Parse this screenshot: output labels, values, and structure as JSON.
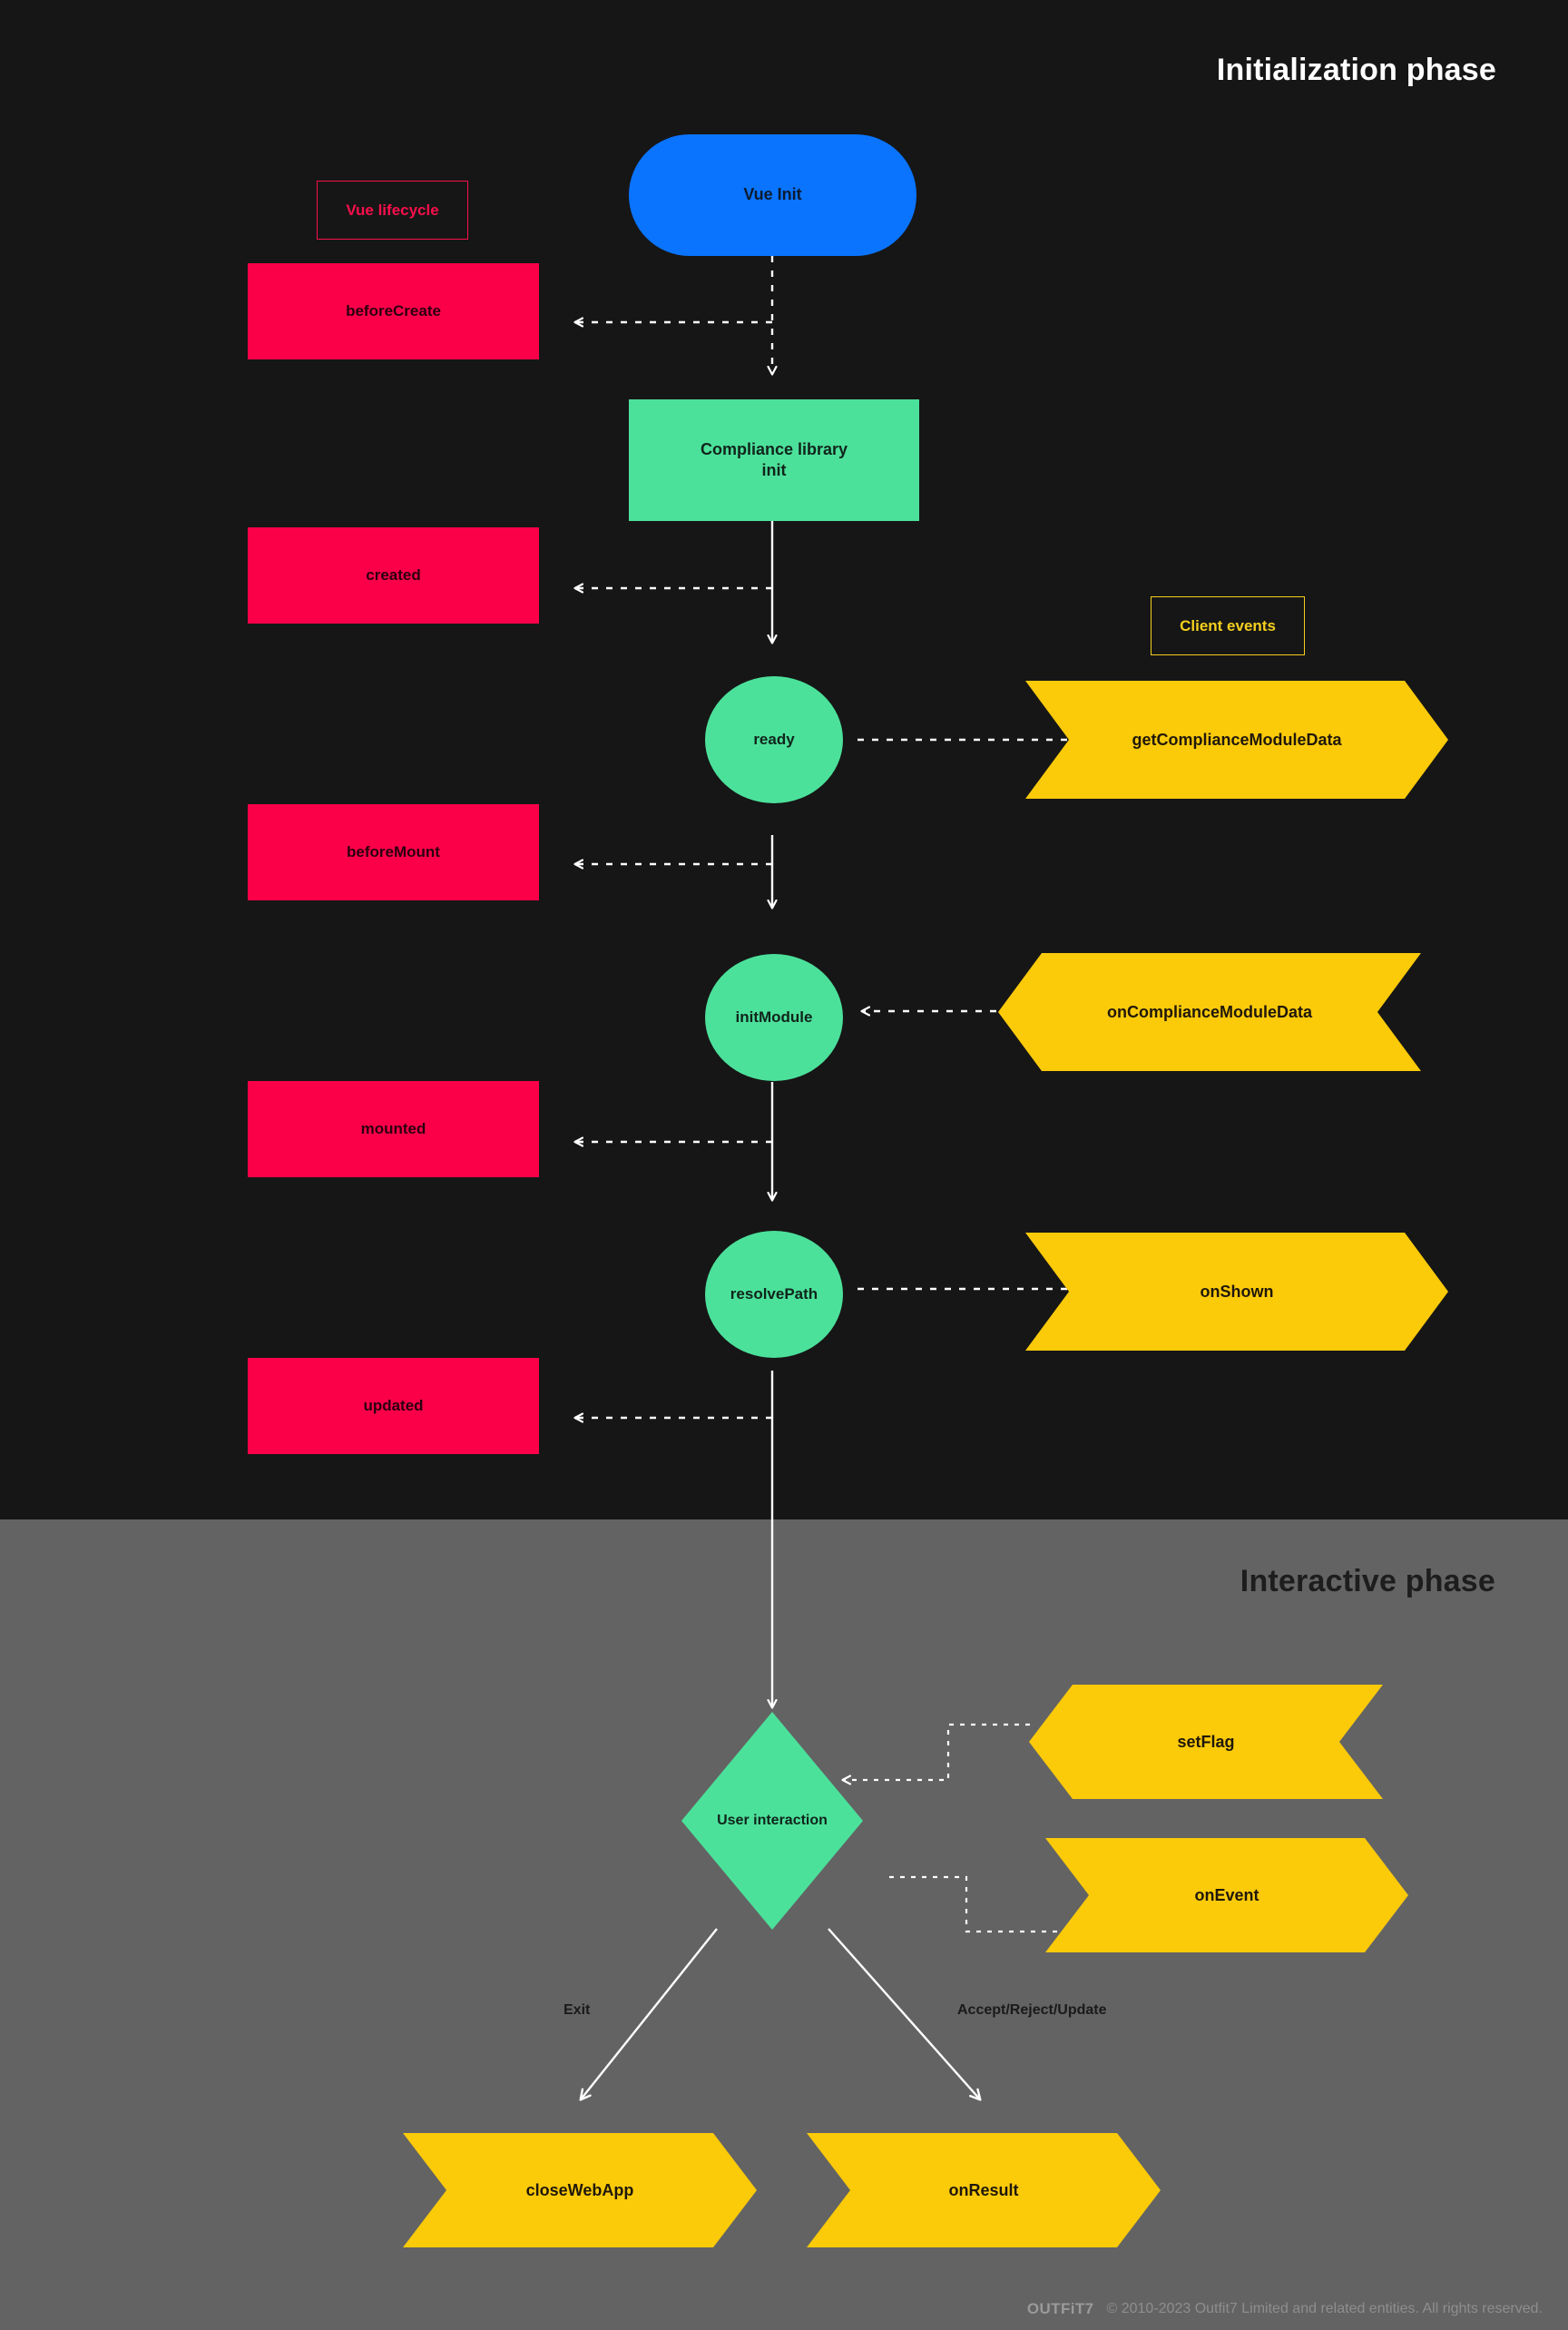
{
  "phases": {
    "initialization": {
      "title": "Initialization phase",
      "bg": "#161616"
    },
    "interactive": {
      "title": "Interactive phase",
      "bg": "#636363"
    }
  },
  "legend": {
    "vue_lifecycle": "Vue lifecycle",
    "client_events": "Client events"
  },
  "colors": {
    "vue_pink": "#fb0049",
    "client_yellow": "#fbca09",
    "process_green": "#4ce19b",
    "vue_blue": "#0a74ff",
    "dark_bg": "#161616",
    "gray_bg": "#636363"
  },
  "nodes": {
    "vue_init": "Vue Init",
    "compliance_library_init": "Compliance library\ninit",
    "ready": "ready",
    "init_module": "initModule",
    "resolve_path": "resolvePath",
    "user_interaction": "User interaction"
  },
  "lifecycle_hooks": [
    "beforeCreate",
    "created",
    "beforeMount",
    "mounted",
    "updated"
  ],
  "client_events": [
    "getComplianceModuleData",
    "onComplianceModuleData",
    "onShown",
    "setFlag",
    "onEvent",
    "closeWebApp",
    "onResult"
  ],
  "edge_labels": {
    "exit": "Exit",
    "accept_reject_update": "Accept/Reject/Update"
  },
  "footer": {
    "brand": "OUTFiT7",
    "copyright": "© 2010-2023 Outfit7 Limited and related entities. All rights reserved."
  }
}
